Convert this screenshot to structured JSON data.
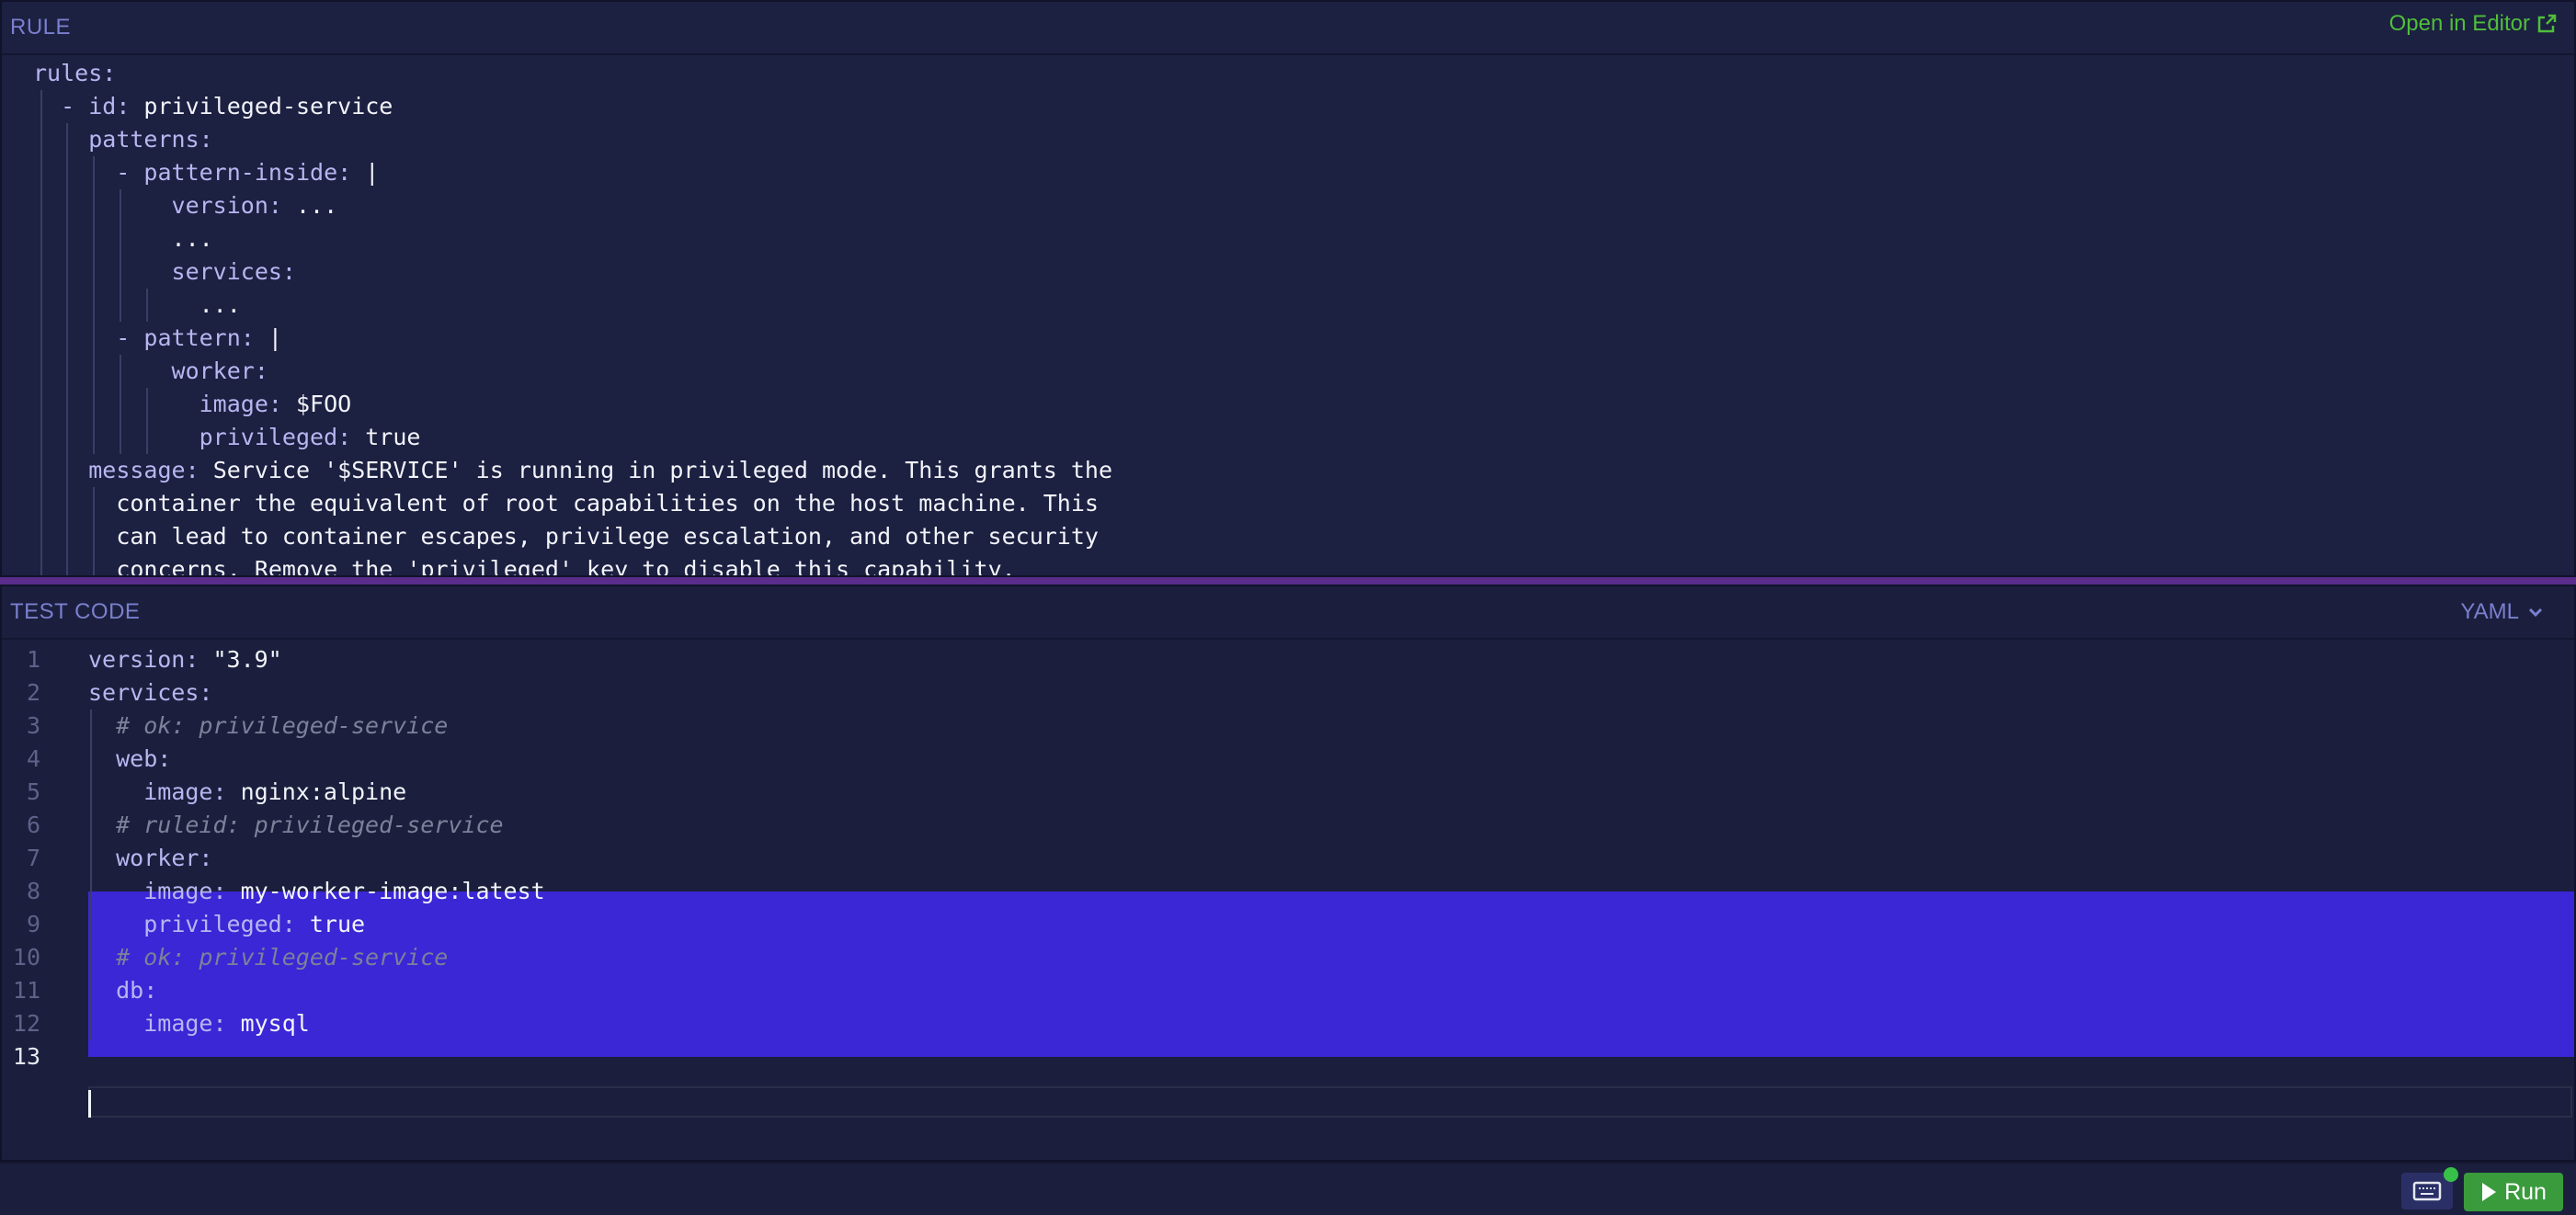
{
  "rule_panel": {
    "title": "RULE",
    "open_in_editor": "Open in Editor",
    "lines": [
      {
        "indent": "",
        "key": "rules:",
        "value": ""
      },
      {
        "indent": "  - ",
        "key": "id:",
        "value": " privileged-service"
      },
      {
        "indent": "    ",
        "key": "patterns:",
        "value": ""
      },
      {
        "indent": "      - ",
        "key": "pattern-inside:",
        "value": " |"
      },
      {
        "indent": "          ",
        "key": "version:",
        "value": " ..."
      },
      {
        "indent": "          ",
        "key": "",
        "value": "..."
      },
      {
        "indent": "          ",
        "key": "services:",
        "value": ""
      },
      {
        "indent": "            ",
        "key": "",
        "value": "..."
      },
      {
        "indent": "      - ",
        "key": "pattern:",
        "value": " |"
      },
      {
        "indent": "          ",
        "key": "worker:",
        "value": ""
      },
      {
        "indent": "            ",
        "key": "image:",
        "value": " $FOO"
      },
      {
        "indent": "            ",
        "key": "privileged:",
        "value": " true"
      },
      {
        "indent": "    ",
        "key": "message:",
        "value": " Service '$SERVICE' is running in privileged mode. This grants the"
      },
      {
        "indent": "      ",
        "key": "",
        "value": "container the equivalent of root capabilities on the host machine. This"
      },
      {
        "indent": "      ",
        "key": "",
        "value": "can lead to container escapes, privilege escalation, and other security"
      },
      {
        "indent": "      ",
        "key": "",
        "value": "concerns. Remove the 'privileged' key to disable this capability."
      }
    ]
  },
  "test_panel": {
    "title": "TEST CODE",
    "language": "YAML",
    "lines": [
      {
        "num": "1",
        "indent": "",
        "key": "version:",
        "value": " \"3.9\"",
        "comment": ""
      },
      {
        "num": "2",
        "indent": "",
        "key": "services:",
        "value": "",
        "comment": ""
      },
      {
        "num": "3",
        "indent": "  ",
        "key": "",
        "value": "",
        "comment": "# ok: privileged-service"
      },
      {
        "num": "4",
        "indent": "  ",
        "key": "web:",
        "value": "",
        "comment": ""
      },
      {
        "num": "5",
        "indent": "    ",
        "key": "image:",
        "value": " nginx:alpine",
        "comment": ""
      },
      {
        "num": "6",
        "indent": "  ",
        "key": "",
        "value": "",
        "comment": "# ruleid: privileged-service"
      },
      {
        "num": "7",
        "indent": "  ",
        "key": "worker:",
        "value": "",
        "comment": ""
      },
      {
        "num": "8",
        "indent": "    ",
        "key": "image:",
        "value": " my-worker-image:latest",
        "comment": ""
      },
      {
        "num": "9",
        "indent": "    ",
        "key": "privileged:",
        "value": " true",
        "comment": ""
      },
      {
        "num": "10",
        "indent": "  ",
        "key": "",
        "value": "",
        "comment": "# ok: privileged-service"
      },
      {
        "num": "11",
        "indent": "  ",
        "key": "db:",
        "value": "",
        "comment": ""
      },
      {
        "num": "12",
        "indent": "    ",
        "key": "image:",
        "value": " mysql",
        "comment": ""
      },
      {
        "num": "13",
        "indent": "",
        "key": "",
        "value": "",
        "comment": ""
      }
    ]
  },
  "footer": {
    "run_label": "Run",
    "keyboard_icon": "keyboard-icon",
    "play_icon": "play-icon"
  },
  "colors": {
    "accent_green": "#4fbf3a",
    "highlight": "#3b27d6",
    "divider": "#5a2c8c",
    "run_button": "#3a9b3c"
  }
}
